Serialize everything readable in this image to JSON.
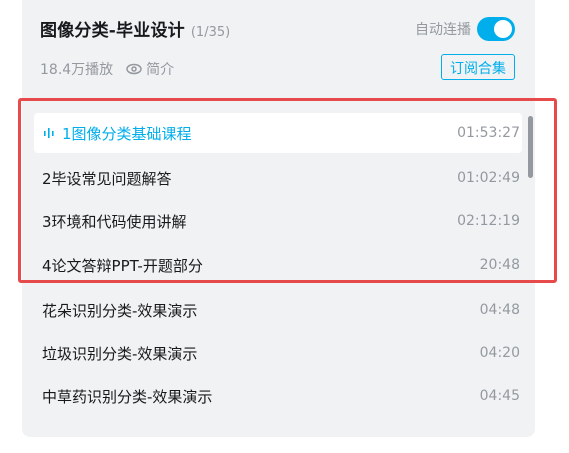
{
  "header": {
    "title": "图像分类-毕业设计",
    "count": "(1/35)",
    "autoplay_label": "自动连播",
    "autoplay_on": true,
    "views": "18.4万播放",
    "intro_label": "简介",
    "subscribe_label": "订阅合集"
  },
  "playlist": {
    "items": [
      {
        "title": "1图像分类基础课程",
        "duration": "01:53:27",
        "active": true
      },
      {
        "title": "2毕设常见问题解答",
        "duration": "01:02:49"
      },
      {
        "title": "3环境和代码使用讲解",
        "duration": "02:12:19"
      },
      {
        "title": "4论文答辩PPT-开题部分",
        "duration": "20:48"
      },
      {
        "title": "花朵识别分类-效果演示",
        "duration": "04:48"
      },
      {
        "title": "垃圾识别分类-效果演示",
        "duration": "04:20"
      },
      {
        "title": "中草药识别分类-效果演示",
        "duration": "04:45"
      }
    ]
  },
  "colors": {
    "accent": "#00aeec",
    "highlight_border": "#e64a4a",
    "panel_bg": "#f1f2f3"
  },
  "icons": {
    "intro": "eye-icon",
    "playing": "playing-bars-icon"
  }
}
